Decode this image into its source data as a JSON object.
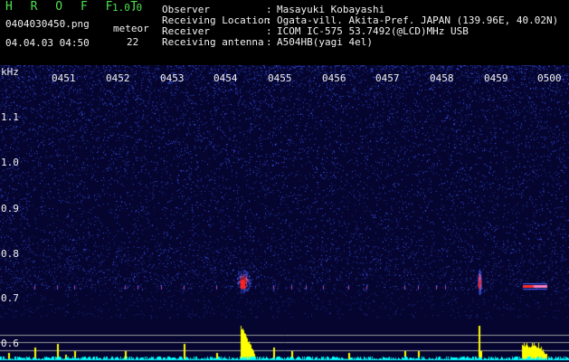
{
  "app": {
    "logo": "H R O F F T",
    "version": "1.0.0"
  },
  "file": {
    "name": "0404030450.png",
    "datetime": "04.04.03 04:50"
  },
  "meteor": {
    "label": "meteor",
    "count": "22"
  },
  "meta": [
    {
      "key": "Observer",
      "value": "Masayuki Kobayashi"
    },
    {
      "key": "Receiving Location",
      "value": "Ogata-vill. Akita-Pref. JAPAN (139.96E, 40.02N)"
    },
    {
      "key": "Receiver",
      "value": "ICOM IC-575 53.7492(@LCD)MHz USB"
    },
    {
      "key": "Receiving antenna",
      "value": "A504HB(yagi 4el)"
    }
  ],
  "axis": {
    "y_unit": "kHz",
    "x_ticks": [
      "0451",
      "0452",
      "0453",
      "0454",
      "0455",
      "0456",
      "0457",
      "0458",
      "0459",
      "0500"
    ],
    "y_ticks": [
      "1.1",
      "1.0",
      "0.9",
      "0.8",
      "0.7",
      "0.6"
    ]
  },
  "colors": {
    "header_green": "#4fe04f",
    "spectrum_bg": "#050530",
    "noise": "#2a3acc",
    "bars": "#ffff00",
    "baseline": "#00ffff"
  }
}
